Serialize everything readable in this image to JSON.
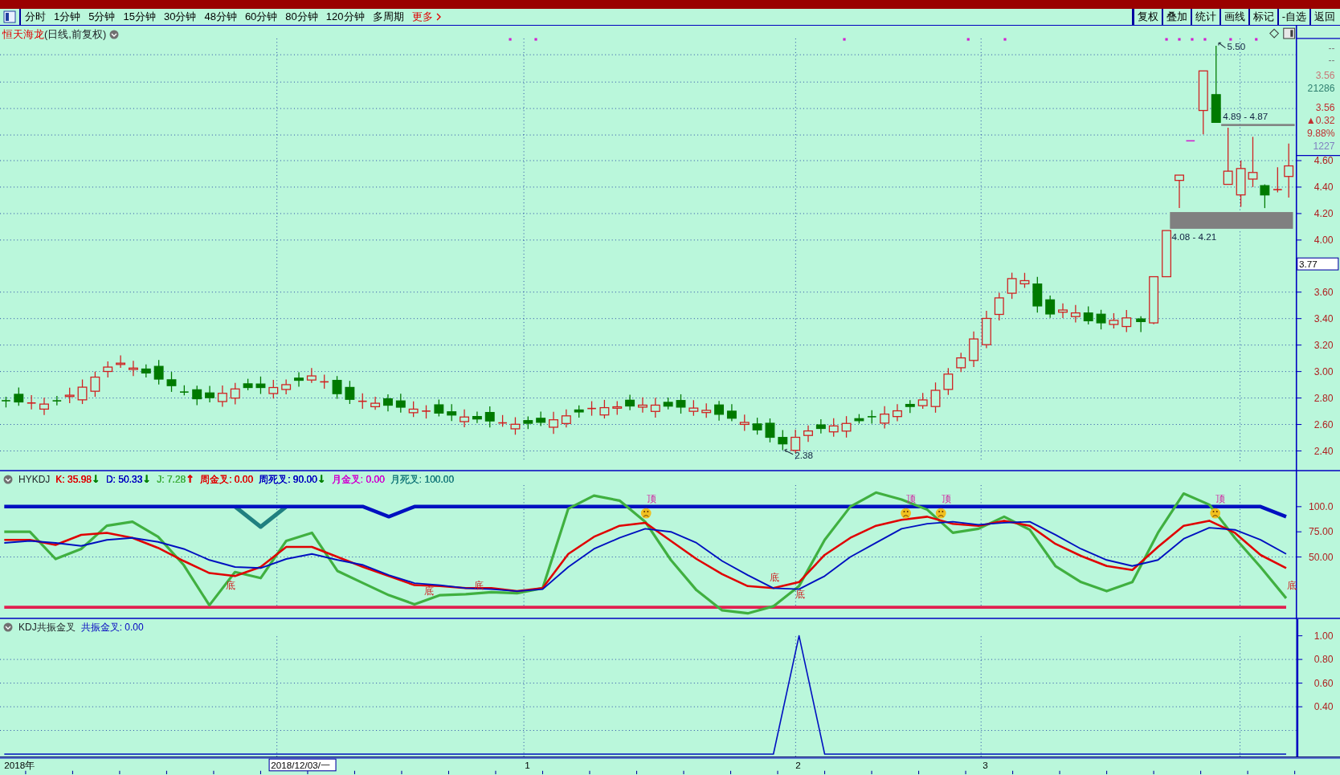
{
  "toolbar": {
    "periods": [
      "分时",
      "1分钟",
      "5分钟",
      "15分钟",
      "30分钟",
      "48分钟",
      "60分钟",
      "80分钟",
      "120分钟",
      "多周期"
    ],
    "more": "更多",
    "actions": [
      "复权",
      "叠加",
      "统计",
      "画线",
      "标记",
      "-自选",
      "返回"
    ]
  },
  "main_chart": {
    "stock_name": "恒天海龙",
    "period": "(日线,前复权)",
    "high_label": "5.50",
    "low_label": "2.38",
    "ranges": [
      "4.89 - 4.87",
      "4.08 - 4.21"
    ],
    "info": [
      {
        "text": "--",
        "color": "#808080"
      },
      {
        "text": "--",
        "color": "#808080"
      },
      {
        "text": "3.56",
        "color": "#c87878"
      },
      {
        "text": "21286",
        "color": "#308070"
      },
      {
        "text": "3.56",
        "color": "#c03030"
      },
      {
        "text": "▲0.32",
        "color": "#c03030"
      },
      {
        "text": "9.88%",
        "color": "#c03030"
      },
      {
        "text": "1227",
        "color": "#8080c0"
      }
    ],
    "price_ticks": [
      "4.60",
      "4.40",
      "4.20",
      "4.00",
      "3.60",
      "3.40",
      "3.20",
      "3.00",
      "2.80",
      "2.60",
      "2.40"
    ],
    "current_price": "3.77"
  },
  "hykdj": {
    "name": "HYKDJ",
    "values": [
      {
        "label": "K: 35.98",
        "arrow": {
          "text": "↓",
          "color": "#008000"
        },
        "color": "#e00000"
      },
      {
        "label": "D: 50.33",
        "arrow": {
          "text": "↓",
          "color": "#008000"
        },
        "color": "#0000c0"
      },
      {
        "label": "J: 7.28",
        "arrow": {
          "text": "↑",
          "color": "#e00000"
        },
        "color": "#40b040"
      },
      {
        "label": "周金叉: 0.00",
        "color": "#e00000"
      },
      {
        "label": "周死叉: 90.00",
        "arrow": {
          "text": "↓",
          "color": "#008000"
        },
        "color": "#0000c0"
      },
      {
        "label": "月金叉: 0.00",
        "color": "#d000d0"
      },
      {
        "label": "月死叉: 100.00",
        "color": "#208080"
      }
    ],
    "chart_data": {
      "type": "line",
      "grid": true,
      "ylim": [
        -11,
        135
      ],
      "yticks": [
        {
          "value": 100,
          "label": "100.0"
        },
        {
          "value": 75,
          "label": "75.00"
        },
        {
          "value": 50,
          "label": "50.00"
        }
      ],
      "series": [
        {
          "color": "#208080",
          "values": [
            null,
            null,
            null,
            null,
            null,
            null,
            null,
            null,
            null,
            100,
            80,
            100,
            null,
            null,
            null,
            null,
            null,
            null,
            null,
            null,
            null,
            null,
            null,
            null,
            null,
            null,
            null,
            null,
            null,
            null,
            null,
            null,
            null,
            null,
            null,
            null,
            null,
            null,
            null,
            null,
            null,
            null,
            null,
            null,
            null,
            null,
            null,
            null,
            null,
            null,
            null
          ]
        },
        {
          "color": "#0010c0",
          "values": [
            100,
            100,
            100,
            100,
            100,
            100,
            100,
            100,
            100,
            100,
            100,
            100,
            100,
            100,
            100,
            90,
            100,
            100,
            100,
            100,
            100,
            100,
            100,
            100,
            100,
            100,
            100,
            100,
            100,
            100,
            100,
            100,
            100,
            100,
            100,
            100,
            100,
            100,
            100,
            100,
            100,
            100,
            100,
            100,
            100,
            100,
            100,
            100,
            100,
            100,
            90
          ]
        },
        {
          "color": "#e02050",
          "values": [
            0,
            0,
            0,
            0,
            0,
            0,
            0,
            0,
            0,
            0,
            0,
            0,
            0,
            0,
            0,
            0,
            0,
            0,
            0,
            0,
            0,
            0,
            0,
            0,
            0,
            0,
            0,
            0,
            0,
            0,
            0,
            0,
            0,
            0,
            0,
            0,
            0,
            0,
            0,
            0,
            0,
            0,
            0,
            0,
            0,
            0,
            0,
            0,
            0,
            0,
            0
          ]
        },
        {
          "color": "#40b040",
          "values": [
            75,
            75,
            48,
            58,
            81,
            85,
            70,
            42,
            2,
            35,
            29,
            66,
            74,
            36,
            24,
            12,
            3,
            12,
            13,
            15,
            14,
            19,
            98,
            111,
            106,
            85,
            47,
            17,
            -3,
            -6,
            1,
            21,
            67,
            100,
            114,
            107,
            97,
            74,
            78,
            90,
            77,
            41,
            25,
            16,
            25,
            74,
            113,
            102,
            69,
            40,
            9
          ]
        },
        {
          "color": "#e00000",
          "values": [
            67,
            67,
            62,
            72,
            74,
            69,
            59,
            46,
            34,
            31,
            40,
            60,
            60,
            50,
            40,
            31,
            22,
            21,
            19,
            19,
            16,
            19,
            53,
            70,
            81,
            84,
            66,
            48,
            33,
            21,
            19,
            25,
            52,
            69,
            81,
            87,
            90,
            83,
            81,
            86,
            81,
            63,
            51,
            41,
            37,
            60,
            81,
            86,
            74,
            52,
            39
          ]
        },
        {
          "color": "#0010c0",
          "values": [
            64,
            66,
            64,
            61,
            67,
            69,
            65,
            58,
            47,
            40,
            39,
            48,
            53,
            47,
            42,
            32,
            24,
            22,
            19,
            18,
            16,
            18,
            40,
            58,
            69,
            78,
            75,
            64,
            46,
            32,
            19,
            18,
            31,
            50,
            64,
            78,
            83,
            85,
            82,
            84,
            85,
            72,
            58,
            47,
            41,
            47,
            68,
            79,
            77,
            67,
            53
          ]
        }
      ]
    },
    "signals": [
      {
        "text": "顶",
        "kind": "top"
      },
      {
        "text": "顶",
        "kind": "top"
      },
      {
        "text": "顶",
        "kind": "top"
      },
      {
        "text": "顶",
        "kind": "top"
      },
      {
        "text": "底",
        "kind": "bottom"
      },
      {
        "text": "底",
        "kind": "bottom"
      },
      {
        "text": "底",
        "kind": "bottom"
      },
      {
        "text": "底",
        "kind": "bottom"
      },
      {
        "text": "底",
        "kind": "bottom"
      },
      {
        "text": "底",
        "kind": "bottom"
      }
    ]
  },
  "kdj_resonance": {
    "name": "KDJ共振金叉",
    "value": "共振金叉: 0.00",
    "chart_data": {
      "type": "line",
      "grid": true,
      "ylim": [
        -0.02,
        1.14
      ],
      "yticks": [
        {
          "value": 1,
          "label": "1.00"
        },
        {
          "value": 0.8,
          "label": "0.80"
        },
        {
          "value": 0.6,
          "label": "0.60"
        },
        {
          "value": 0.4,
          "label": "0.40"
        }
      ],
      "series": [
        {
          "color": "#0010c0",
          "values": [
            0,
            0,
            0,
            0,
            0,
            0,
            0,
            0,
            0,
            0,
            0,
            0,
            0,
            0,
            0,
            0,
            0,
            0,
            0,
            0,
            0,
            0,
            0,
            0,
            0,
            0,
            0,
            0,
            0,
            0,
            0,
            1,
            0,
            0,
            0,
            0,
            0,
            0,
            0,
            0,
            0,
            0,
            0,
            0,
            0,
            0,
            0,
            0,
            0,
            0,
            0
          ]
        }
      ]
    }
  },
  "date_axis": [
    {
      "text": "2018年",
      "kind": "plain"
    },
    {
      "text": "2018/12/03/一",
      "kind": "boxed"
    },
    {
      "text": "1",
      "kind": "plain"
    },
    {
      "text": "2",
      "kind": "plain"
    },
    {
      "text": "3",
      "kind": "plain"
    }
  ]
}
